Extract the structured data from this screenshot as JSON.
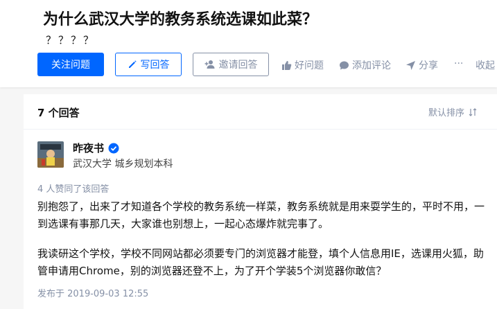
{
  "question": {
    "title": "为什么武汉大学的教务系统选课如此菜？",
    "detail": "？？？？"
  },
  "actions": {
    "follow": "关注问题",
    "write_answer": "写回答",
    "invite": "邀请回答",
    "upvote": "好问题",
    "comment": "添加评论",
    "share": "分享",
    "more": "···",
    "collapse": "收起"
  },
  "answers_header": {
    "count_label": "7 个回答",
    "sort_label": "默认排序"
  },
  "answer": {
    "author_name": "昨夜书",
    "author_bio": "武汉大学 城乡规划本科",
    "votes": "4 人赞同了该回答",
    "paragraphs": [
      "别抱怨了，出来了才知道各个学校的教务系统一样菜，教务系统就是用来耍学生的，平时不用，一到选课有事那几天，大家谁也别想上，一起心态爆炸就完事了。",
      "我读研这个学校，学校不同网站都必须要专门的浏览器才能登，填个人信息用IE，选课用火狐，助管申请用Chrome，别的浏览器还登不上，为了开个学装5个浏览器你敢信？"
    ],
    "published": "发布于 2019-09-03 12:55"
  },
  "colors": {
    "accent": "#0066ff",
    "muted": "#8590a6",
    "text": "#121212"
  },
  "icons": {
    "write": "pencil-icon",
    "invite": "add-user-icon",
    "upvote": "thumbs-up-icon",
    "comment": "comment-icon",
    "share": "paper-plane-icon",
    "sort": "sort-icon",
    "verified": "verified-badge-icon"
  }
}
